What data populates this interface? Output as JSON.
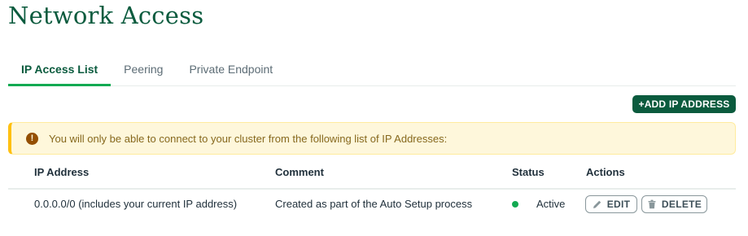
{
  "page": {
    "title": "Network Access"
  },
  "tabs": [
    {
      "label": "IP Access List",
      "active": true
    },
    {
      "label": "Peering",
      "active": false
    },
    {
      "label": "Private Endpoint",
      "active": false
    }
  ],
  "toolbar": {
    "add_label": "+ADD IP ADDRESS"
  },
  "banner": {
    "icon": "warning-circle-icon",
    "icon_glyph": "!",
    "text": "You will only be able to connect to your cluster from the following list of IP Addresses:"
  },
  "table": {
    "headers": {
      "ip": "IP Address",
      "comment": "Comment",
      "status": "Status",
      "actions": "Actions"
    },
    "rows": [
      {
        "ip": "0.0.0.0/0  (includes your current IP address)",
        "comment": "Created as part of the Auto Setup process",
        "status": "Active",
        "edit_label": "EDIT",
        "delete_label": "DELETE"
      }
    ]
  },
  "colors": {
    "brand_dark_green": "#0b5b3e",
    "accent_green": "#13aa52",
    "warning_bg": "#fef7db",
    "warning_border": "#ffc010"
  }
}
